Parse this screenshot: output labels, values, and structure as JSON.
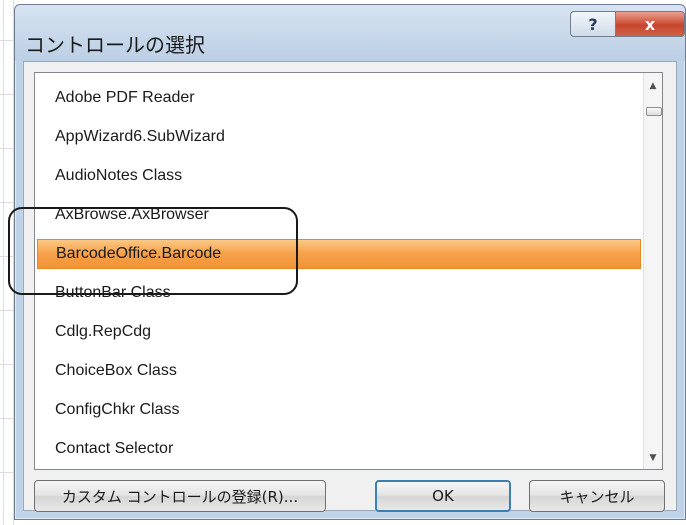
{
  "dialog": {
    "title": "コントロールの選択",
    "help_glyph": "?",
    "close_glyph": "x"
  },
  "controls": {
    "items": [
      {
        "label": "Adobe PDF Reader",
        "selected": false
      },
      {
        "label": "AppWizard6.SubWizard",
        "selected": false
      },
      {
        "label": "AudioNotes Class",
        "selected": false
      },
      {
        "label": "AxBrowse.AxBrowser",
        "selected": false
      },
      {
        "label": "BarcodeOffice.Barcode",
        "selected": true
      },
      {
        "label": "ButtonBar Class",
        "selected": false
      },
      {
        "label": "Cdlg.RepCdg",
        "selected": false
      },
      {
        "label": "ChoiceBox Class",
        "selected": false
      },
      {
        "label": "ConfigChkr Class",
        "selected": false
      },
      {
        "label": "Contact Selector",
        "selected": false
      }
    ]
  },
  "scroll": {
    "up_glyph": "▲",
    "down_glyph": "▼"
  },
  "buttons": {
    "register_label": "カスタム コントロールの登録(R)...",
    "ok_label": "OK",
    "cancel_label": "キャンセル"
  },
  "colors": {
    "selection": "#f6a04a",
    "titlebar": "#c9d9ec",
    "close": "#c7452c"
  }
}
